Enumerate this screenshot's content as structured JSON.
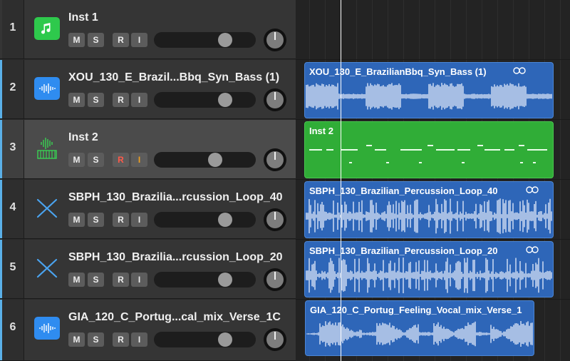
{
  "tracks": [
    {
      "number": "1",
      "name": "Inst 1",
      "icon": "music-note-icon",
      "mute": "M",
      "solo": "S",
      "record": "R",
      "input": "I"
    },
    {
      "number": "2",
      "name": "XOU_130_E_Brazil...Bbq_Syn_Bass (1)",
      "icon": "waveform-icon",
      "mute": "M",
      "solo": "S",
      "record": "R",
      "input": "I"
    },
    {
      "number": "3",
      "name": "Inst 2",
      "icon": "keyboard-icon",
      "mute": "M",
      "solo": "S",
      "record": "R",
      "input": "I"
    },
    {
      "number": "4",
      "name": "SBPH_130_Brazilia...rcussion_Loop_40",
      "icon": "drumsticks-icon",
      "mute": "M",
      "solo": "S",
      "record": "R",
      "input": "I"
    },
    {
      "number": "5",
      "name": "SBPH_130_Brazilia...rcussion_Loop_20",
      "icon": "drumsticks-icon",
      "mute": "M",
      "solo": "S",
      "record": "R",
      "input": "I"
    },
    {
      "number": "6",
      "name": "GIA_120_C_Portug...cal_mix_Verse_1C",
      "icon": "waveform-icon",
      "mute": "M",
      "solo": "S",
      "record": "R",
      "input": "I"
    }
  ],
  "regions": [
    {
      "title": "XOU_130_E_BrazilianBbq_Syn_Bass (1)",
      "type": "audio",
      "looped": true
    },
    {
      "title": "Inst 2",
      "type": "midi",
      "looped": false
    },
    {
      "title": "SBPH_130_Brazilian_Percussion_Loop_40",
      "type": "audio",
      "looped": true
    },
    {
      "title": "SBPH_130_Brazilian_Percussion_Loop_20",
      "type": "audio",
      "looped": true
    },
    {
      "title": "GIA_120_C_Portug_Feeling_Vocal_mix_Verse_1",
      "type": "audio",
      "looped": false
    }
  ],
  "colors": {
    "midi_region": "#30ad37",
    "audio_region": "#2e66b8",
    "software_instrument_icon": "#2ec94c",
    "audio_track_icon": "#2f8cf0",
    "record_armed": "#ff5a4a",
    "input_monitor": "#f0a020"
  }
}
